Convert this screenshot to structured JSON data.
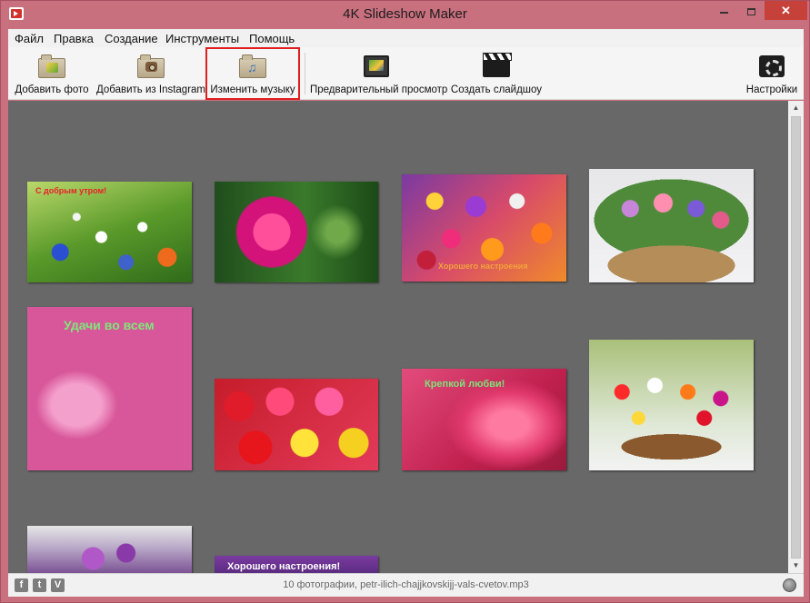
{
  "window": {
    "title": "4K Slideshow Maker",
    "minimize": "–",
    "maximize": "□",
    "close": "✕"
  },
  "menu": {
    "items": [
      "Файл",
      "Правка",
      "Создание",
      "Инструменты",
      "Помощь"
    ]
  },
  "toolbar": {
    "add_photo": "Добавить фото",
    "add_instagram": "Добавить из Instagram",
    "change_music": "Изменить музыку",
    "preview": "Предварительный просмотр",
    "create_slideshow": "Создать слайдшоу",
    "settings": "Настройки",
    "icons": [
      "folder-photo-icon",
      "folder-camera-icon",
      "folder-music-icon",
      "preview-icon",
      "clapperboard-icon",
      "settings-icon"
    ]
  },
  "photos": [
    {
      "caption": "С добрым утром!",
      "caption_color": "#e8202a"
    },
    {
      "caption": ""
    },
    {
      "caption": "Хорошего настроения",
      "caption_color": "#f2a23c"
    },
    {
      "caption": ""
    },
    {
      "caption": "Удачи во всем",
      "caption_color": "#7ee87a"
    },
    {
      "caption": ""
    },
    {
      "caption": "Крепкой любви!",
      "caption_color": "#7de27a"
    },
    {
      "caption": ""
    },
    {
      "caption": ""
    },
    {
      "caption": "Хорошего настроения!",
      "caption_color": "#ffffff"
    }
  ],
  "status": {
    "text": "10 фотографии, petr-ilich-chajjkovskijj-vals-cvetov.mp3",
    "social": [
      "f",
      "t",
      "V"
    ]
  },
  "colors": {
    "window_frame": "#c9707f",
    "content_bg": "#686868",
    "highlight": "#e01e1e",
    "close_button": "#c7413b"
  }
}
